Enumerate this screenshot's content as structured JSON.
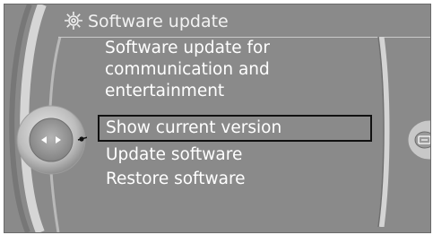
{
  "header": {
    "title": "Software update",
    "icon": "gear-icon"
  },
  "menu": {
    "heading_lines": [
      "Software update for",
      "communication and",
      "entertainment"
    ],
    "items": [
      {
        "label": "Show current version",
        "selected": true
      },
      {
        "label": "Update software",
        "selected": false
      },
      {
        "label": "Restore software",
        "selected": false
      }
    ]
  },
  "controller": {
    "icon": "controller-knob-icon",
    "left_arrow": "left-arrow-icon",
    "right_arrow": "right-arrow-icon"
  },
  "side_button": {
    "icon": "options-icon"
  },
  "colors": {
    "screen_background": "#8a8a8a",
    "text": "#ffffff",
    "selection_border": "#111111"
  }
}
